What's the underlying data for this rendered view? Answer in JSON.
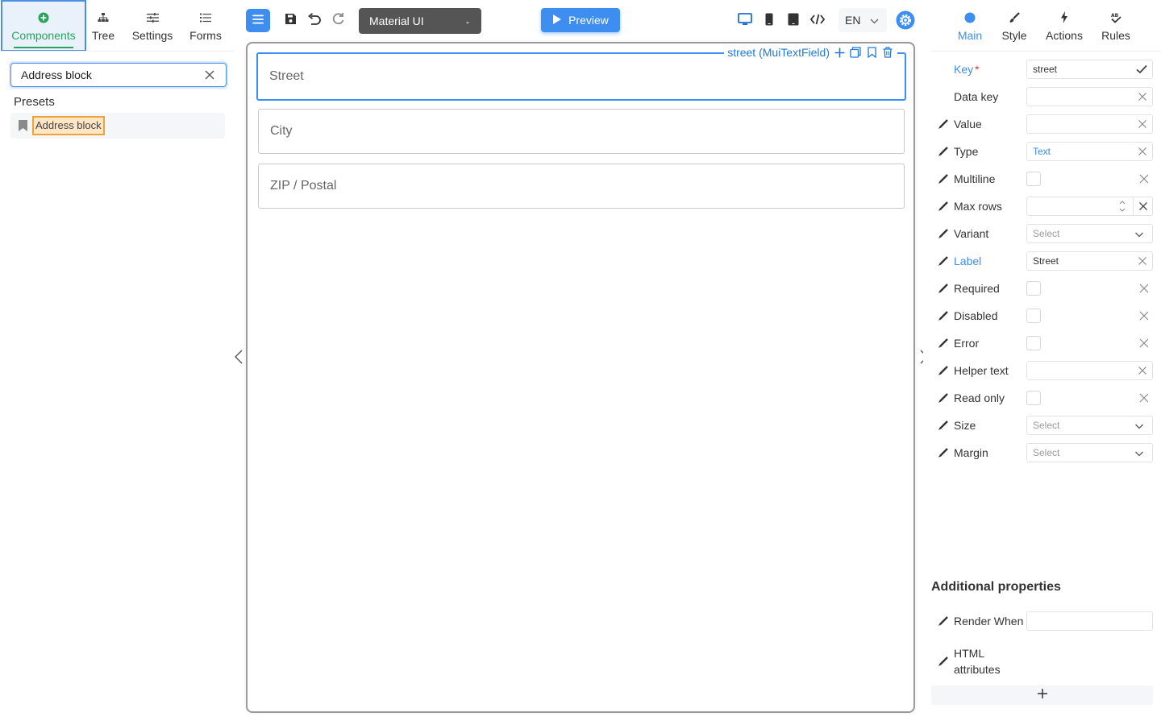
{
  "left_tabs": [
    {
      "label": "Components",
      "icon": "plus-circle-icon"
    },
    {
      "label": "Tree",
      "icon": "tree-icon"
    },
    {
      "label": "Settings",
      "icon": "sliders-icon"
    },
    {
      "label": "Forms",
      "icon": "list-icon"
    }
  ],
  "search": {
    "value": "Address block"
  },
  "presets": {
    "title": "Presets",
    "items": [
      {
        "label": "Address block",
        "icon": "bookmark-icon"
      }
    ]
  },
  "toolbar": {
    "theme": "Material UI",
    "preview_label": "Preview",
    "language": "EN"
  },
  "canvas": {
    "fields": [
      {
        "label": "Street",
        "selected": true
      },
      {
        "label": "City",
        "selected": false
      },
      {
        "label": "ZIP / Postal",
        "selected": false
      }
    ],
    "selected_tag": "street (MuiTextField)"
  },
  "right_tabs": [
    {
      "label": "Main",
      "icon": "circle-icon"
    },
    {
      "label": "Style",
      "icon": "brush-icon"
    },
    {
      "label": "Actions",
      "icon": "bolt-icon"
    },
    {
      "label": "Rules",
      "icon": "rules-icon"
    }
  ],
  "properties": [
    {
      "name": "Key",
      "value": "street",
      "required_mark": "*"
    },
    {
      "name": "Data key",
      "value": ""
    },
    {
      "name": "Value",
      "value": ""
    },
    {
      "name": "Type",
      "value": "Text"
    },
    {
      "name": "Multiline"
    },
    {
      "name": "Max rows",
      "value": ""
    },
    {
      "name": "Variant",
      "placeholder": "Select"
    },
    {
      "name": "Label",
      "value": "Street"
    },
    {
      "name": "Required"
    },
    {
      "name": "Disabled"
    },
    {
      "name": "Error"
    },
    {
      "name": "Helper text",
      "value": ""
    },
    {
      "name": "Read only"
    },
    {
      "name": "Size",
      "placeholder": "Select"
    },
    {
      "name": "Margin",
      "placeholder": "Select"
    }
  ],
  "additional": {
    "title": "Additional properties",
    "items": [
      {
        "name": "Render When",
        "value": ""
      },
      {
        "name": "HTML attributes"
      }
    ],
    "add_label": "+"
  },
  "colors": {
    "accent": "#3d8ef0",
    "active_tab_green": "#2aa35d",
    "highlight_orange": "#f0a23a",
    "dark_select": "#555555"
  }
}
